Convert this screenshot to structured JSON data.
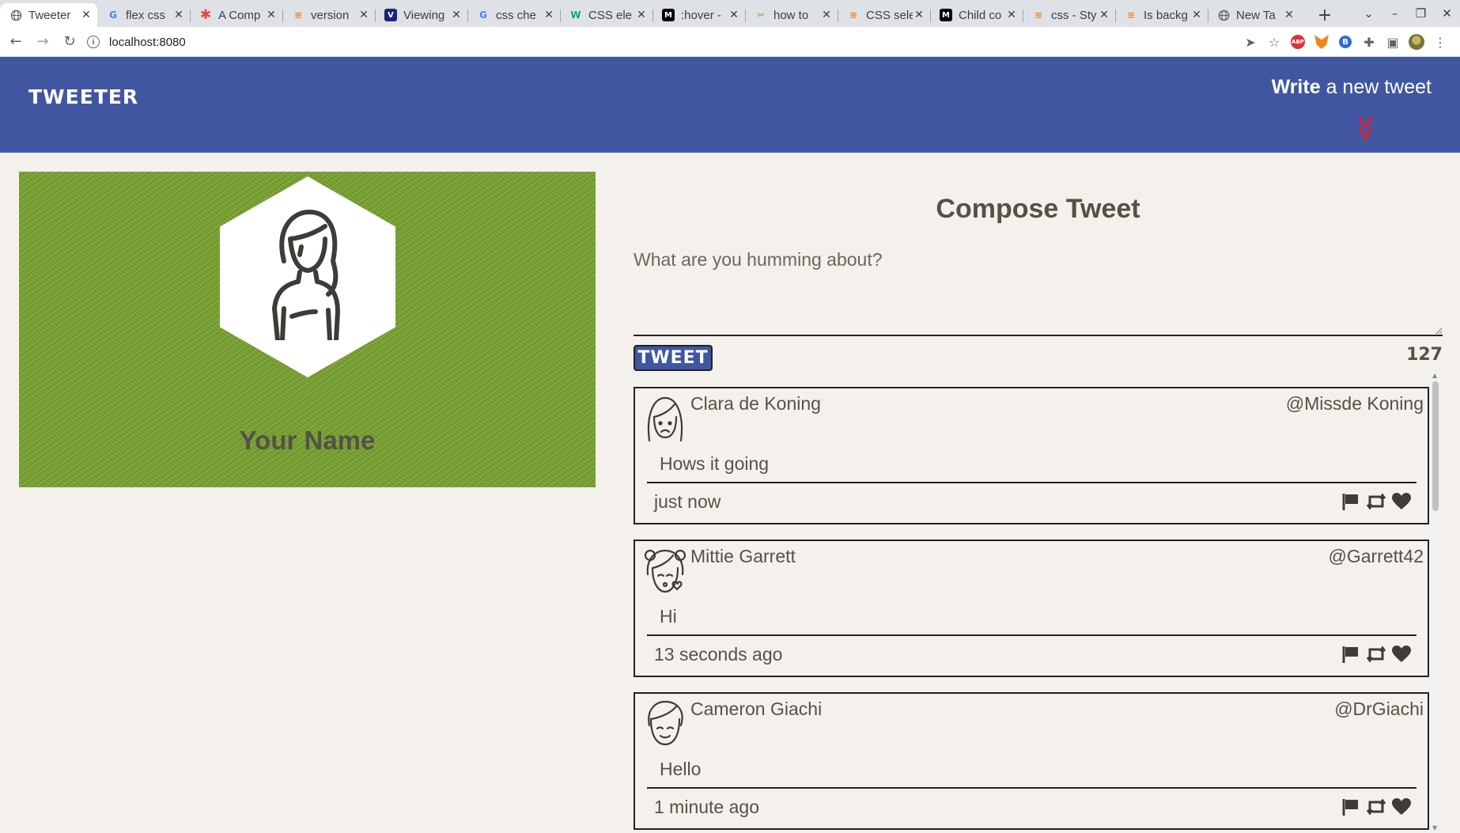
{
  "browser": {
    "tabs": [
      {
        "title": "Tweeter",
        "icon": "globe-icon",
        "active": true
      },
      {
        "title": "flex css",
        "icon": "google-icon"
      },
      {
        "title": "A Comp",
        "icon": "asterisk-icon"
      },
      {
        "title": "version",
        "icon": "stackoverflow-icon"
      },
      {
        "title": "Viewing",
        "icon": "site-icon"
      },
      {
        "title": "css che",
        "icon": "google-icon"
      },
      {
        "title": "CSS ele",
        "icon": "w3-icon"
      },
      {
        "title": ":hover -",
        "icon": "mdn-icon"
      },
      {
        "title": "how to",
        "icon": "site-icon"
      },
      {
        "title": "CSS sele",
        "icon": "stackoverflow-icon"
      },
      {
        "title": "Child co",
        "icon": "mdn-icon"
      },
      {
        "title": "css - Sty",
        "icon": "stackoverflow-icon"
      },
      {
        "title": "Is backg",
        "icon": "stackoverflow-icon"
      },
      {
        "title": "New Ta",
        "icon": "globe-icon"
      }
    ],
    "url": "localhost:8080"
  },
  "header": {
    "brand": "TWEETER",
    "write_bold": "Write",
    "write_rest": "a new tweet"
  },
  "profile": {
    "name": "Your Name"
  },
  "composer": {
    "title": "Compose Tweet",
    "placeholder": "What are you humming about?",
    "button_label": "TWEET",
    "counter": "127"
  },
  "tweets": [
    {
      "name": "Clara de Koning",
      "handle": "@Missde Koning",
      "text": "Hows it going",
      "time": "just now"
    },
    {
      "name": "Mittie Garrett",
      "handle": "@Garrett42",
      "text": "Hi",
      "time": "13 seconds ago"
    },
    {
      "name": "Cameron Giachi",
      "handle": "@DrGiachi",
      "text": "Hello",
      "time": "1 minute ago"
    }
  ],
  "colors": {
    "header_bg": "#4056a1",
    "profile_bg": "#78a22f",
    "accent_red": "#d0233a",
    "text": "#545149",
    "page_bg": "#f4f1ec"
  }
}
